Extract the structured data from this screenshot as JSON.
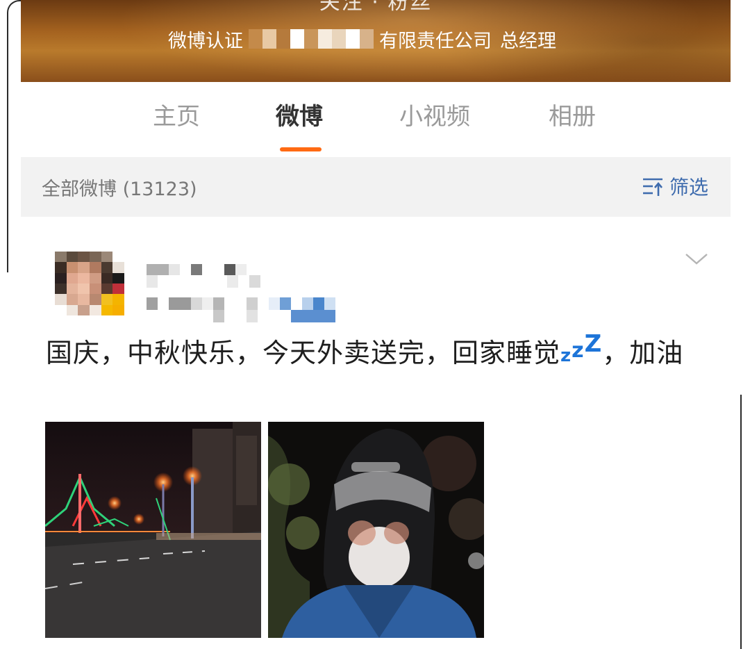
{
  "banner": {
    "stats_partial": "关注 ·    粉丝",
    "verify_label": "微博认证",
    "company_suffix": "有限责任公司",
    "title": "总经理"
  },
  "tabs": [
    {
      "label": "主页",
      "active": false
    },
    {
      "label": "微博",
      "active": true
    },
    {
      "label": "小视频",
      "active": false
    },
    {
      "label": "相册",
      "active": false
    }
  ],
  "filter_bar": {
    "count_label": "全部微博 (13123)",
    "filter_label": "筛选",
    "filter_icon": "sort-filter-icon"
  },
  "post": {
    "text_before": "国庆，中秋快乐，今天外卖送完，回家睡觉",
    "emoji": "sleeping-zzz-icon",
    "text_after": "，加油",
    "more_icon": "chevron-down-icon",
    "images": [
      {
        "icon": "night-bridge-photo"
      },
      {
        "icon": "helmet-selfie-photo"
      }
    ]
  },
  "colors": {
    "accent": "#ff6a13",
    "link": "#3f6cae",
    "zzz": "#1d74d8",
    "filter_bg": "#f2f2f2"
  }
}
